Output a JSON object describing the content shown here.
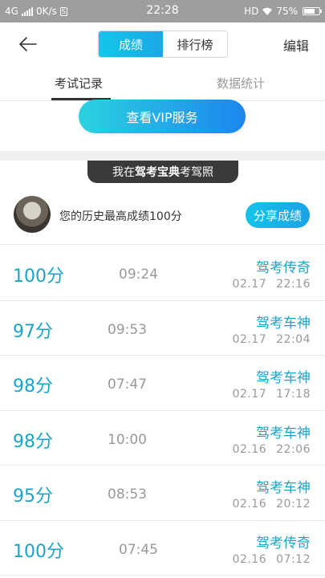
{
  "status_bar": {
    "network": "4G",
    "speed": "0K/s",
    "time": "22:28",
    "hd": "HD",
    "battery": "75%"
  },
  "header": {
    "segments": [
      "成绩",
      "排行榜"
    ],
    "active_segment": "成绩",
    "edit": "编辑"
  },
  "tabs": {
    "items": [
      "考试记录",
      "数据统计"
    ],
    "active": "考试记录"
  },
  "vip": {
    "label": "查看VIP服务"
  },
  "banner": {
    "prefix": "我在",
    "brand": "驾考宝典",
    "suffix": "考驾照"
  },
  "best": {
    "text": "您的历史最高成绩100分",
    "share": "分享成绩"
  },
  "records": [
    {
      "score": "100分",
      "duration": "09:24",
      "title": "驾考传奇",
      "date": "02.17",
      "time": "22:16"
    },
    {
      "score": "97分",
      "duration": "09:53",
      "title": "驾考车神",
      "date": "02.17",
      "time": "22:04"
    },
    {
      "score": "98分",
      "duration": "07:47",
      "title": "驾考车神",
      "date": "02.17",
      "time": "17:18"
    },
    {
      "score": "98分",
      "duration": "10:00",
      "title": "驾考车神",
      "date": "02.16",
      "time": "22:06"
    },
    {
      "score": "95分",
      "duration": "08:53",
      "title": "驾考车神",
      "date": "02.16",
      "time": "20:12"
    },
    {
      "score": "100分",
      "duration": "07:45",
      "title": "驾考传奇",
      "date": "02.16",
      "time": "07:12"
    }
  ],
  "colors": {
    "accent": "#1aa5c8",
    "status_bar": "#9e9e9e",
    "banner": "#3a3a3a"
  }
}
